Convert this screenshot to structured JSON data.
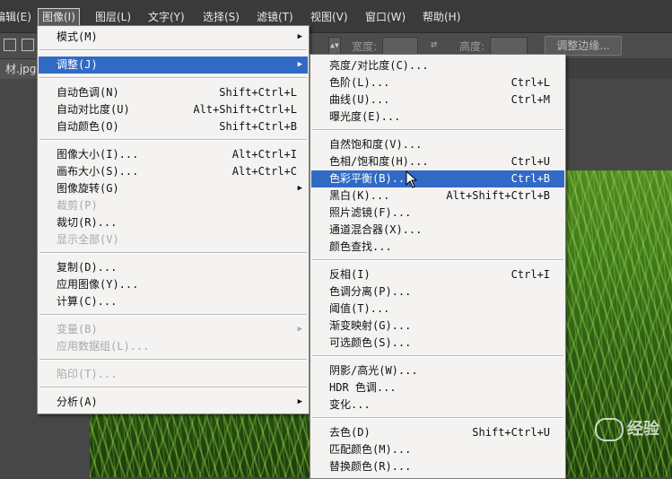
{
  "menubar": {
    "items": [
      "编辑(E)",
      "图像(I)",
      "图层(L)",
      "文字(Y)",
      "选择(S)",
      "滤镜(T)",
      "视图(V)",
      "窗口(W)",
      "帮助(H)"
    ]
  },
  "optbar": {
    "width_label": "宽度:",
    "height_label": "高度:",
    "refine_edge": "调整边缘..."
  },
  "tab": {
    "label": "材.jpg"
  },
  "image_menu": [
    {
      "label": "模式(M)",
      "shortcut": "",
      "submenu": true
    },
    {
      "sep": true
    },
    {
      "label": "调整(J)",
      "shortcut": "",
      "submenu": true,
      "highlighted": true
    },
    {
      "sep": true
    },
    {
      "label": "自动色调(N)",
      "shortcut": "Shift+Ctrl+L"
    },
    {
      "label": "自动对比度(U)",
      "shortcut": "Alt+Shift+Ctrl+L"
    },
    {
      "label": "自动颜色(O)",
      "shortcut": "Shift+Ctrl+B"
    },
    {
      "sep": true
    },
    {
      "label": "图像大小(I)...",
      "shortcut": "Alt+Ctrl+I"
    },
    {
      "label": "画布大小(S)...",
      "shortcut": "Alt+Ctrl+C"
    },
    {
      "label": "图像旋转(G)",
      "shortcut": "",
      "submenu": true
    },
    {
      "label": "裁剪(P)",
      "shortcut": "",
      "disabled": true
    },
    {
      "label": "裁切(R)...",
      "shortcut": ""
    },
    {
      "label": "显示全部(V)",
      "shortcut": "",
      "disabled": true
    },
    {
      "sep": true
    },
    {
      "label": "复制(D)...",
      "shortcut": ""
    },
    {
      "label": "应用图像(Y)...",
      "shortcut": ""
    },
    {
      "label": "计算(C)...",
      "shortcut": ""
    },
    {
      "sep": true
    },
    {
      "label": "变量(B)",
      "shortcut": "",
      "submenu": true,
      "disabled": true
    },
    {
      "label": "应用数据组(L)...",
      "shortcut": "",
      "disabled": true
    },
    {
      "sep": true
    },
    {
      "label": "陷印(T)...",
      "shortcut": "",
      "disabled": true
    },
    {
      "sep": true
    },
    {
      "label": "分析(A)",
      "shortcut": "",
      "submenu": true
    }
  ],
  "adjust_menu": [
    {
      "label": "亮度/对比度(C)...",
      "shortcut": ""
    },
    {
      "label": "色阶(L)...",
      "shortcut": "Ctrl+L"
    },
    {
      "label": "曲线(U)...",
      "shortcut": "Ctrl+M"
    },
    {
      "label": "曝光度(E)...",
      "shortcut": ""
    },
    {
      "sep": true
    },
    {
      "label": "自然饱和度(V)...",
      "shortcut": ""
    },
    {
      "label": "色相/饱和度(H)...",
      "shortcut": "Ctrl+U"
    },
    {
      "label": "色彩平衡(B)...",
      "shortcut": "Ctrl+B",
      "highlighted": true
    },
    {
      "label": "黑白(K)...",
      "shortcut": "Alt+Shift+Ctrl+B"
    },
    {
      "label": "照片滤镜(F)...",
      "shortcut": ""
    },
    {
      "label": "通道混合器(X)...",
      "shortcut": ""
    },
    {
      "label": "颜色查找...",
      "shortcut": ""
    },
    {
      "sep": true
    },
    {
      "label": "反相(I)",
      "shortcut": "Ctrl+I"
    },
    {
      "label": "色调分离(P)...",
      "shortcut": ""
    },
    {
      "label": "阈值(T)...",
      "shortcut": ""
    },
    {
      "label": "渐变映射(G)...",
      "shortcut": ""
    },
    {
      "label": "可选颜色(S)...",
      "shortcut": ""
    },
    {
      "sep": true
    },
    {
      "label": "阴影/高光(W)...",
      "shortcut": ""
    },
    {
      "label": "HDR 色调...",
      "shortcut": ""
    },
    {
      "label": "变化...",
      "shortcut": ""
    },
    {
      "sep": true
    },
    {
      "label": "去色(D)",
      "shortcut": "Shift+Ctrl+U"
    },
    {
      "label": "匹配颜色(M)...",
      "shortcut": ""
    },
    {
      "label": "替换颜色(R)...",
      "shortcut": ""
    }
  ],
  "watermark": "经验"
}
